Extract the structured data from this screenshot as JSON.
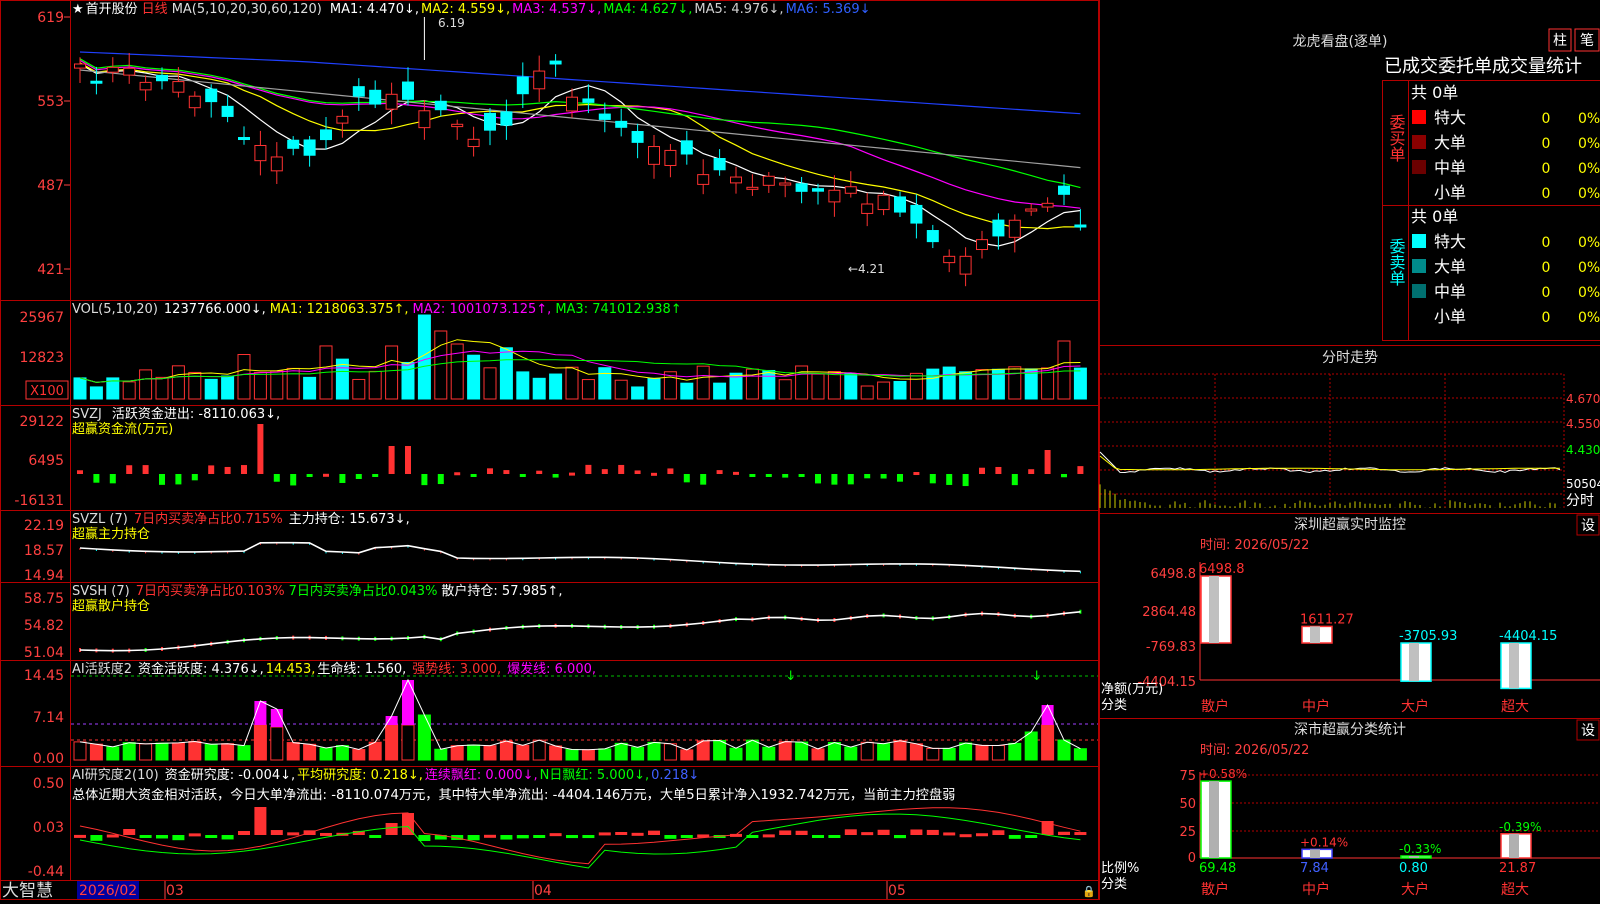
{
  "stock_header": {
    "star": "★",
    "stock_name": "首开股份",
    "period": "日线",
    "ma_def": "MA(5,10,20,30,60,120)",
    "ma1": "MA1: 4.470↓,",
    "ma2": "MA2: 4.559↓,",
    "ma3": "MA3: 4.537↓,",
    "ma4": "MA4: 4.627↓,",
    "ma5": "MA5: 4.976↓,",
    "ma6": "MA6: 5.369↓"
  },
  "price_axis": [
    "619",
    "553",
    "487",
    "421"
  ],
  "price_marks": {
    "high": "6.19",
    "low": "←4.21"
  },
  "vol_panel": {
    "title": "VOL(5,10,20)",
    "value": "1237766.000↓,",
    "ma1": "MA1: 1218063.375↑,",
    "ma2": "MA2: 1001073.125↑,",
    "ma3": "MA3: 741012.938↑",
    "axis": [
      "25967",
      "12823"
    ],
    "unit": "X100"
  },
  "svzj_panel": {
    "title": "SVZJ",
    "text": "活跃资金进出: -8110.063↓,",
    "subtitle": "超赢资金流(万元)",
    "axis": [
      "29122",
      "6495",
      "-16131"
    ]
  },
  "svzl_panel": {
    "title": "SVZL (7)",
    "red_text": "7日内买卖净占比0.715%",
    "text": "主力持仓: 15.673↓,",
    "subtitle": "超赢主力持仓",
    "axis": [
      "22.19",
      "18.57",
      "14.94"
    ]
  },
  "svsh_panel": {
    "title": "SVSH (7)",
    "red_text": "7日内买卖净占比0.103%",
    "green_text": "7日内买卖净占比0.043%",
    "text": "散户持仓: 57.985↑,",
    "subtitle": "超赢散户持仓",
    "axis": [
      "58.75",
      "54.82",
      "51.04"
    ]
  },
  "ai_active_panel": {
    "title": "AI活跃度2",
    "text1": "资金活跃度: 4.376↓,",
    "text2": "14.453,",
    "text3": "生命线: 1.560,",
    "text4": "强势线: 3.000,",
    "text5": "爆发线: 6.000,",
    "axis": [
      "14.45",
      "7.14",
      "0.00"
    ]
  },
  "ai_research_panel": {
    "title": "AI研究度2(10)",
    "text1": "资金研究度: -0.004↓,",
    "text2": "平均研究度: 0.218↓,",
    "text3": "连续飘红: 0.000↓,",
    "text4": "N日飘红: 5.000↓,",
    "text5": "0.218↓",
    "summary": "总体近期大资金相对活跃，今日大单净流出: -8110.074万元，其中特大单净流出: -4404.146万元，大单5日累计净入1932.742万元，当前主力控盘弱",
    "axis": [
      "0.50",
      "0.03",
      "-0.44"
    ]
  },
  "bottom_bar": {
    "brand": "大智慧",
    "dates": [
      "2026/02",
      "03",
      "04",
      "05"
    ]
  },
  "dragon_tiger": {
    "title": "龙虎看盘(逐单)",
    "btn_zhu": "柱",
    "btn_bi": "笔",
    "subtitle": "已成交委托单成交量统计",
    "buy_label": "委买单",
    "buy_total": "共 0单",
    "sell_label": "委卖单",
    "sell_total": "共 0单",
    "rows": [
      {
        "label": "特大",
        "count": "0",
        "pct": "0%"
      },
      {
        "label": "大单",
        "count": "0",
        "pct": "0%"
      },
      {
        "label": "中单",
        "count": "0",
        "pct": "0%"
      },
      {
        "label": "小单",
        "count": "0",
        "pct": "0%"
      }
    ],
    "buy_colors": [
      "#ff0000",
      "#8b0000",
      "#6b0000",
      "#000000"
    ],
    "sell_colors": [
      "#00ffff",
      "#008b8b",
      "#007070",
      "#000000"
    ]
  },
  "intraday": {
    "title": "分时走势",
    "axis": [
      "4.670",
      "4.550",
      "4.430"
    ],
    "vol_label": "50504",
    "label": "分时"
  },
  "sz_monitor": {
    "title": "深圳超赢实时监控",
    "btn": "设",
    "time": "时间: 2026/05/22",
    "axis": [
      "6498.8",
      "2864.48",
      "-769.83",
      "-4404.15"
    ],
    "axis_title": "净额(万元)",
    "cat_title": "分类",
    "categories": [
      "散户",
      "中户",
      "大户",
      "超大"
    ],
    "values": [
      "6498.8",
      "1611.27",
      "-3705.93",
      "-4404.15"
    ],
    "value_numbers": [
      6498.8,
      1611.27,
      -3705.93,
      -4404.15
    ]
  },
  "sz_class": {
    "title": "深市超赢分类统计",
    "btn": "设",
    "time": "时间: 2026/05/22",
    "axis": [
      "75",
      "50",
      "25",
      "0"
    ],
    "axis_title": "比例%",
    "cat_title": "分类",
    "categories": [
      "散户",
      "中户",
      "大户",
      "超大"
    ],
    "bar_values": [
      "69.48",
      "7.84",
      "0.80",
      "21.87"
    ],
    "bar_numbers": [
      69.48,
      7.84,
      0.8,
      21.87
    ],
    "change_values": [
      "+0.58%",
      "+0.14%",
      "-0.33%",
      "-0.39%"
    ]
  },
  "colors": {
    "up": "#ff3232",
    "down": "#00ffff",
    "grid_red": "#b40000",
    "ma1": "#ffffff",
    "ma2": "#ffff00",
    "ma3": "#ff00ff",
    "ma4": "#00ff00",
    "ma5": "#a0a0a0",
    "ma6": "#2040ff"
  }
}
